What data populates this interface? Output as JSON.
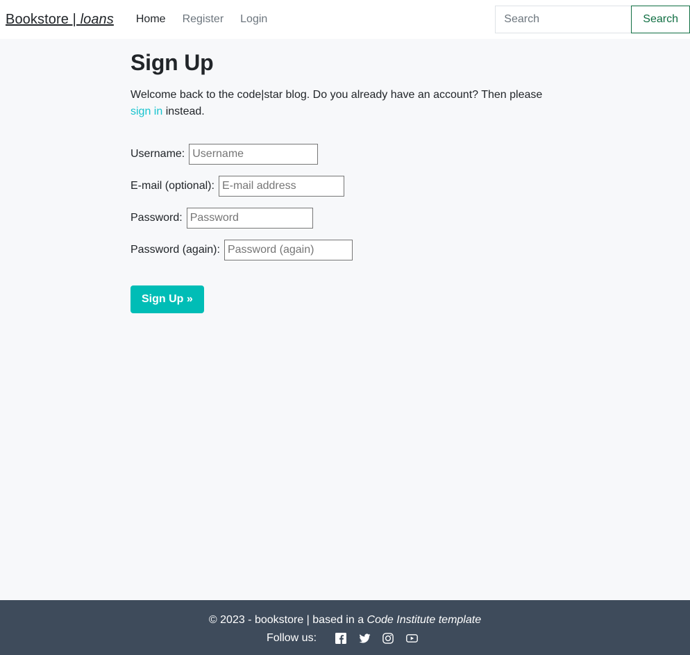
{
  "header": {
    "brand_prefix": "Bookstore | ",
    "brand_italic": "loans",
    "nav": [
      {
        "label": "Home",
        "active": true
      },
      {
        "label": "Register",
        "active": false
      },
      {
        "label": "Login",
        "active": false
      }
    ],
    "search": {
      "placeholder": "Search",
      "value": "",
      "button_label": "Search",
      "button_color": "#0f6e42"
    }
  },
  "main": {
    "title": "Sign Up",
    "intro_before": "Welcome back to the code|star blog. Do you already have an account? Then please ",
    "intro_link": "sign in",
    "intro_after": " instead.",
    "link_color": "#17c3ce",
    "form": {
      "fields": [
        {
          "label": "Username:",
          "placeholder": "Username",
          "value": "",
          "type": "text",
          "name": "username"
        },
        {
          "label": "E-mail (optional):",
          "placeholder": "E-mail address",
          "value": "",
          "type": "text",
          "name": "email"
        },
        {
          "label": "Password:",
          "placeholder": "Password",
          "value": "",
          "type": "password",
          "name": "password"
        },
        {
          "label": "Password (again):",
          "placeholder": "Password (again)",
          "value": "",
          "type": "password",
          "name": "password-again"
        }
      ],
      "submit_label": "Sign Up »",
      "submit_color": "#00bdb6"
    }
  },
  "footer": {
    "copyright_text": "© 2023 - bookstore | based in a ",
    "template_text": "Code Institute template",
    "follow_label": "Follow us:",
    "background_color": "#3e4b5b",
    "social": [
      {
        "name": "facebook",
        "label": "Facebook"
      },
      {
        "name": "twitter",
        "label": "Twitter"
      },
      {
        "name": "instagram",
        "label": "Instagram"
      },
      {
        "name": "youtube",
        "label": "YouTube"
      }
    ]
  }
}
